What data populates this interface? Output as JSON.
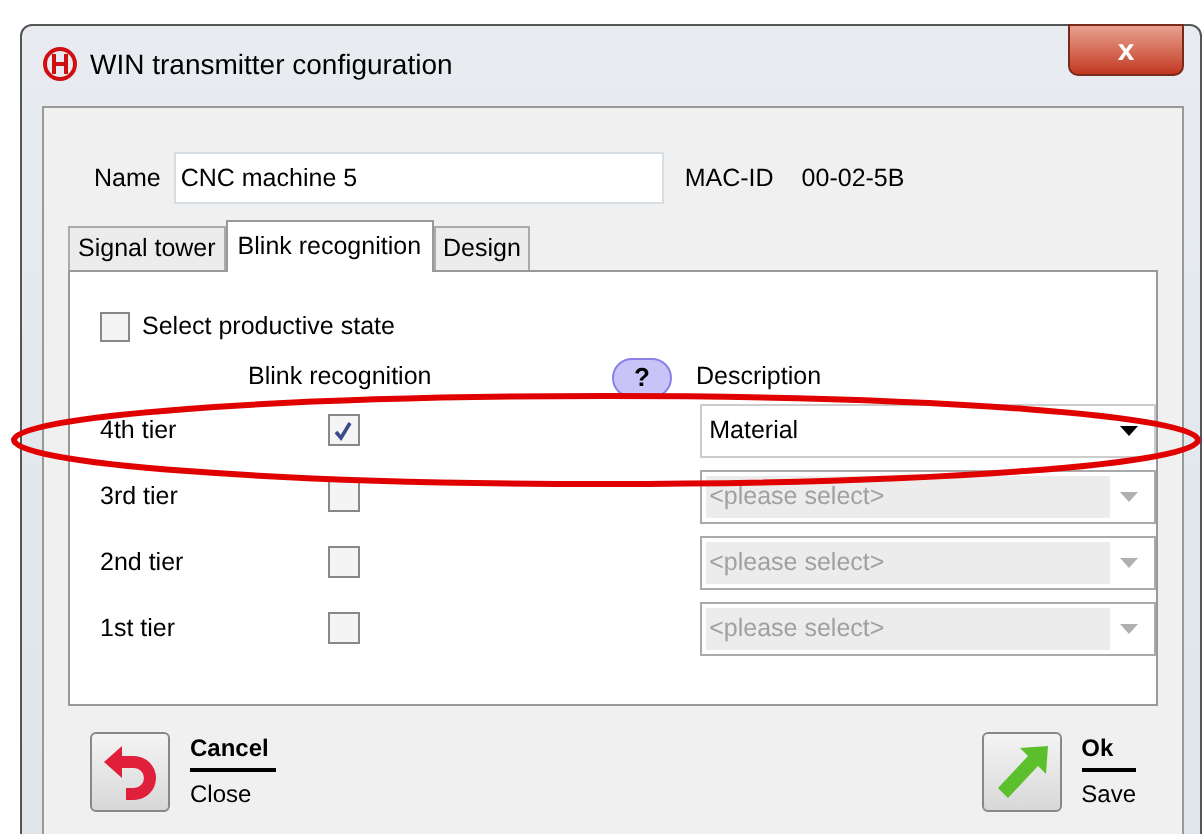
{
  "window": {
    "title": "WIN transmitter configuration",
    "close": "x"
  },
  "name_label": "Name",
  "name_value": "CNC machine 5",
  "mac_label": "MAC-ID",
  "mac_value": "00-02-5B",
  "tabs": [
    {
      "label": "Signal tower",
      "selected": false
    },
    {
      "label": "Blink recognition",
      "selected": true
    },
    {
      "label": "Design",
      "selected": false
    }
  ],
  "productive": {
    "label": "Select productive state",
    "checked": false
  },
  "headers": {
    "blink": "Blink recognition",
    "help": "?",
    "description": "Description"
  },
  "rows": [
    {
      "label": "4th tier",
      "checked": true,
      "value": "Material",
      "disabled": false
    },
    {
      "label": "3rd tier",
      "checked": false,
      "placeholder": "<please select>",
      "disabled": true
    },
    {
      "label": "2nd tier",
      "checked": false,
      "placeholder": "<please select>",
      "disabled": true
    },
    {
      "label": "1st tier",
      "checked": false,
      "placeholder": "<please select>",
      "disabled": true
    }
  ],
  "buttons": [
    {
      "kind": "cancel",
      "title": "Cancel",
      "subtitle": "Close"
    },
    {
      "kind": "ok",
      "title": "Ok",
      "subtitle": "Save"
    }
  ]
}
